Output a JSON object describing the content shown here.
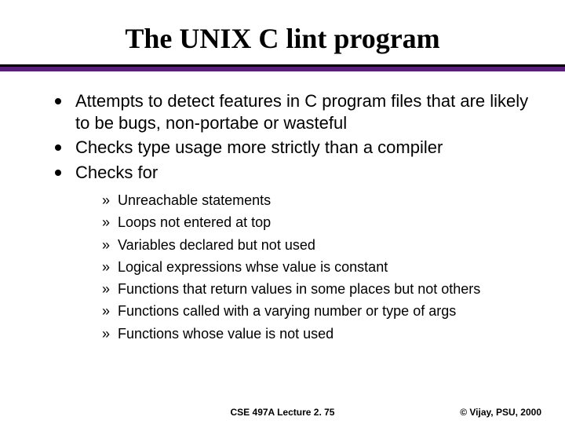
{
  "title": "The UNIX C lint program",
  "main_items": [
    "Attempts to detect features in C program files that are likely to be bugs, non-portabe or wasteful",
    "Checks type usage more strictly than a compiler",
    "Checks for"
  ],
  "sub_items": [
    "Unreachable statements",
    "Loops not entered at top",
    "Variables declared but not used",
    "Logical expressions whse value is constant",
    "Functions that return values in some places but not others",
    "Functions called with a varying number or type of args",
    "Functions whose value is not used"
  ],
  "footer_center": "CSE 497A Lecture 2. 75",
  "footer_right": "© Vijay, PSU, 2000",
  "sub_bullet_glyph": "»"
}
